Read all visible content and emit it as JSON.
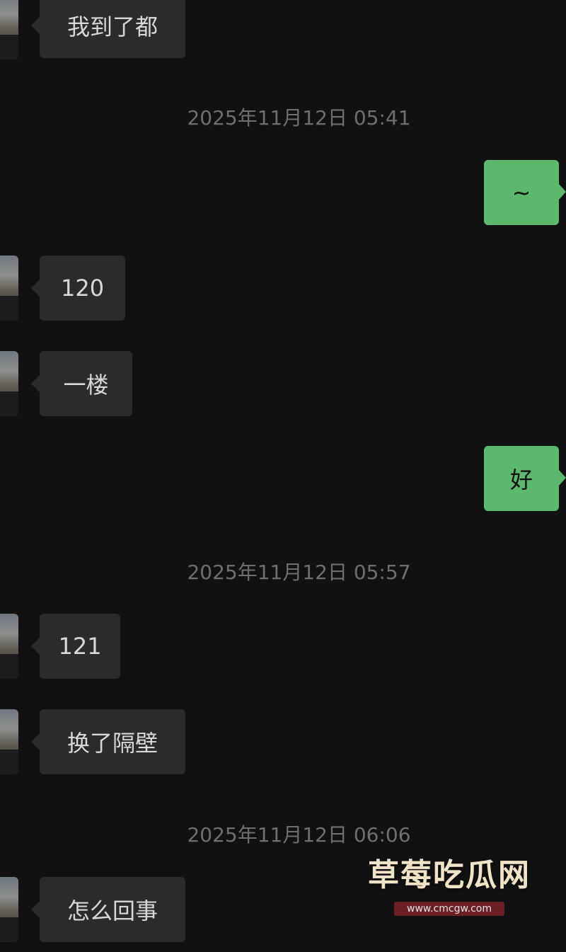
{
  "messages": [
    {
      "side": "in",
      "text": "我到了都"
    },
    {
      "side": "out",
      "text": "~"
    },
    {
      "side": "in",
      "text": "120"
    },
    {
      "side": "in",
      "text": "一楼"
    },
    {
      "side": "out",
      "text": "好"
    },
    {
      "side": "in",
      "text": "121"
    },
    {
      "side": "in",
      "text": "换了隔壁"
    },
    {
      "side": "in",
      "text": "怎么回事"
    }
  ],
  "timestamps": [
    "2025年11月12日 05:41",
    "2025年11月12日 05:57",
    "2025年11月12日 06:06"
  ],
  "watermark": {
    "title": "草莓吃瓜网",
    "url": "www.cmcgw.com"
  },
  "colors": {
    "background": "#111111",
    "incoming_bubble": "#2b2b2b",
    "outgoing_bubble": "#5bb86c",
    "timestamp_text": "#6f6f6f"
  }
}
